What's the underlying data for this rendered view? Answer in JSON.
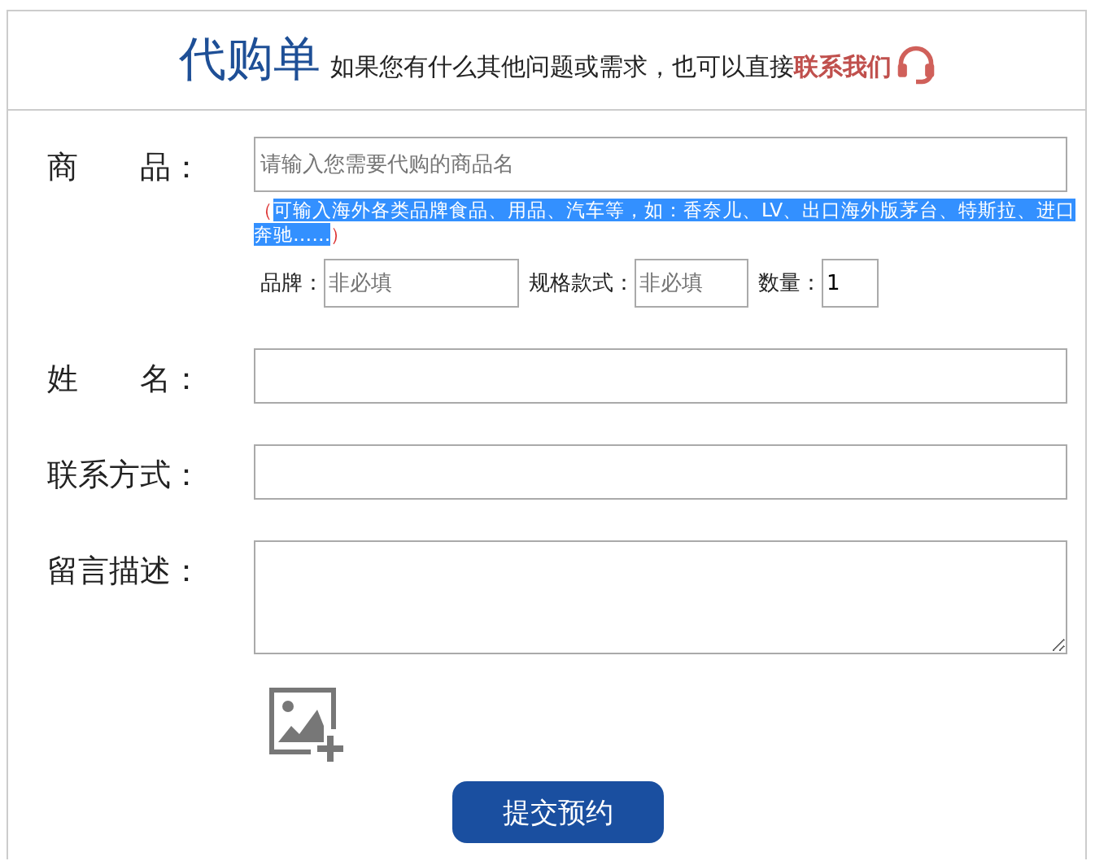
{
  "header": {
    "title": "代购单",
    "message": "如果您有什么其他问题或需求，也可以直接",
    "contact_link": "联系我们"
  },
  "product": {
    "label": "商　　品：",
    "placeholder": "请输入您需要代购的商品名",
    "hint": {
      "open": "（",
      "text": "可输入海外各类品牌食品、用品、汽车等，如：香奈儿、LV、出口海外版茅台、特斯拉、进口奔驰……",
      "close": "）",
      "selected": true
    },
    "subfields": [
      {
        "label": "品牌：",
        "placeholder": "非必填"
      },
      {
        "label": "规格款式：",
        "placeholder": "非必填"
      },
      {
        "label": "数量：",
        "value": "1"
      }
    ]
  },
  "fields": [
    {
      "label": "姓　　名：",
      "kind": "input"
    },
    {
      "label": "联系方式：",
      "kind": "input"
    },
    {
      "label": "留言描述：",
      "kind": "textarea"
    }
  ],
  "submit": "提交预约"
}
